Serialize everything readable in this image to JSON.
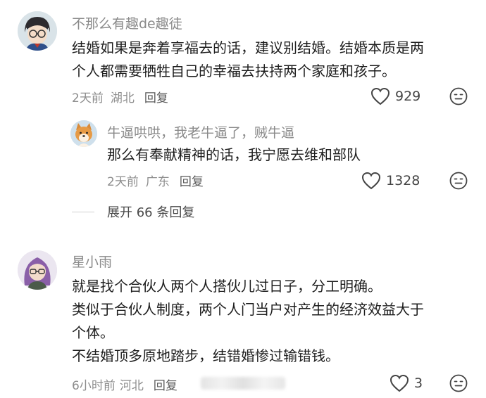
{
  "comments": [
    {
      "user": "不那么有趣de趣徒",
      "lines": [
        "结婚如果是奔着享福去的话，建议别结婚。结婚本质是两",
        "个人都需要牺牲自己的幸福去扶持两个家庭和孩子。"
      ],
      "time": "2天前",
      "location": "湖北",
      "reply_label": "回复",
      "likes": "929",
      "replies": [
        {
          "user": "牛逼哄哄，我老牛逼了，贼牛逼",
          "lines": [
            "那么有奉献精神的话，我宁愿去维和部队"
          ],
          "time": "2天前",
          "location": "广东",
          "reply_label": "回复",
          "likes": "1328"
        }
      ],
      "expand_label": "展开 66 条回复"
    },
    {
      "user": "星小雨",
      "lines": [
        "就是找个合伙人两个人搭伙儿过日子，分工明确。",
        "类似于合伙人制度，两个人门当户对产生的经济效益大于",
        "个体。",
        "不结婚顶多原地踏步，结错婚惨过输错钱。"
      ],
      "time": "6小时前",
      "location": "河北",
      "reply_label": "回复",
      "likes": "3"
    }
  ],
  "icons": {
    "like": "heart-outline-icon",
    "dislike": "neutral-face-icon"
  },
  "colors": {
    "text": "#1e1e1e",
    "meta": "#8d8d8d",
    "username": "#8a8a8a"
  }
}
